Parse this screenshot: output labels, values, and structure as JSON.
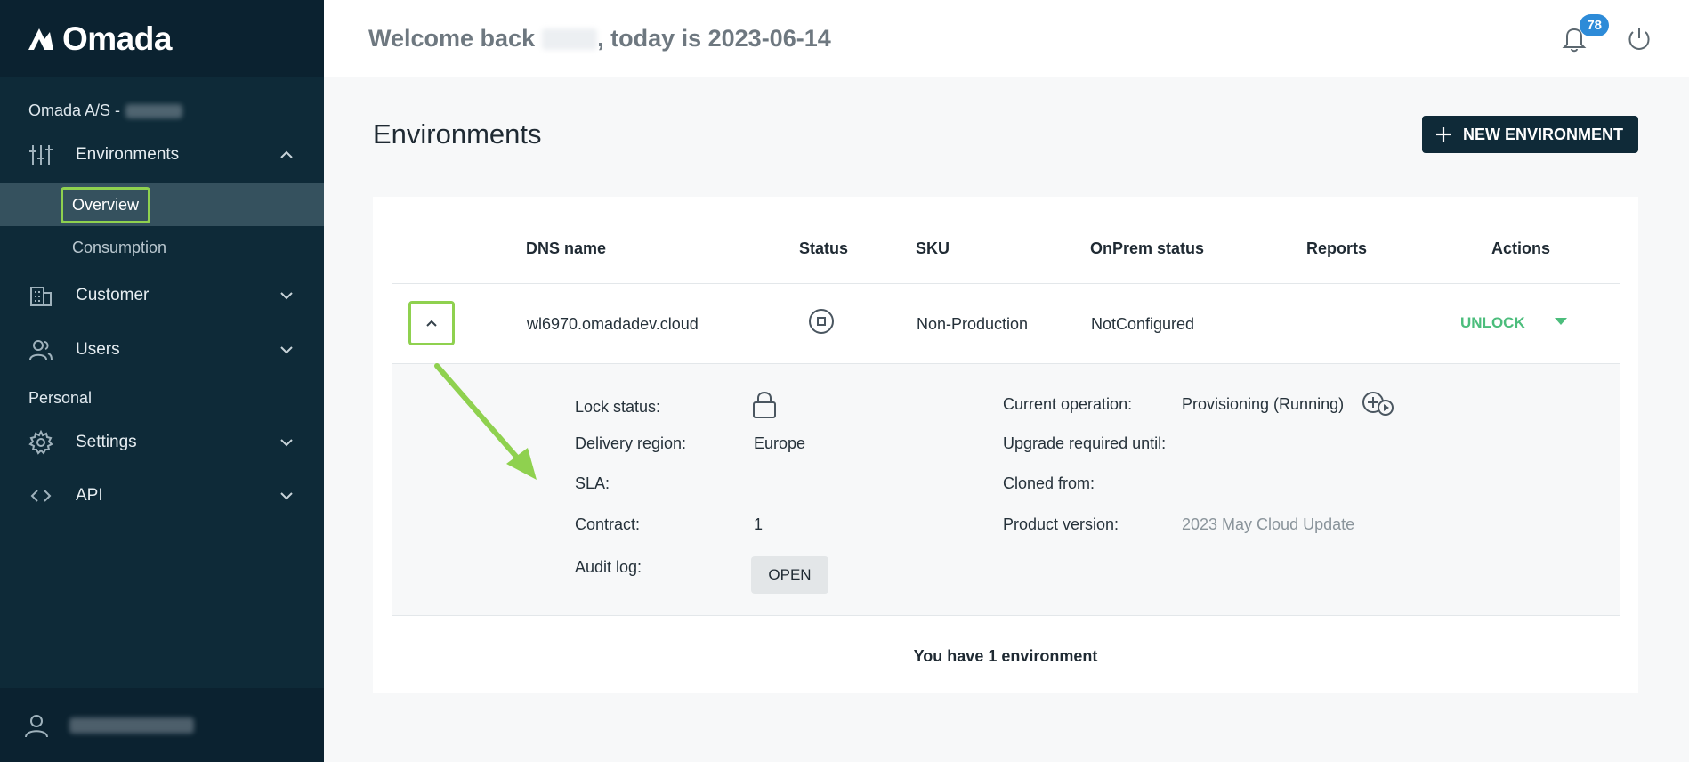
{
  "brand": {
    "name": "Omada"
  },
  "sidebar": {
    "org_label": "Omada A/S -",
    "nav": [
      {
        "label": "Environments",
        "icon": "sliders-icon",
        "expanded": true
      },
      {
        "label": "Customer",
        "icon": "building-icon"
      },
      {
        "label": "Users",
        "icon": "users-icon"
      },
      {
        "label": "Settings",
        "icon": "gear-icon"
      },
      {
        "label": "API",
        "icon": "code-icon"
      }
    ],
    "sub_items": [
      {
        "label": "Overview",
        "active": true
      },
      {
        "label": "Consumption"
      }
    ],
    "section_personal": "Personal"
  },
  "header": {
    "welcome_prefix": "Welcome back",
    "welcome_suffix": ", today is 2023-06-14",
    "notification_count": "78"
  },
  "page": {
    "title": "Environments",
    "new_button": "NEW ENVIRONMENT"
  },
  "table": {
    "columns": [
      "DNS name",
      "Status",
      "SKU",
      "OnPrem status",
      "Reports",
      "Actions"
    ],
    "row": {
      "dns": "wl6970.omadadev.cloud",
      "sku": "Non-Production",
      "onprem": "NotConfigured",
      "action": "UNLOCK"
    },
    "details": {
      "lock_status_label": "Lock status:",
      "delivery_region_label": "Delivery region:",
      "delivery_region_value": "Europe",
      "sla_label": "SLA:",
      "contract_label": "Contract:",
      "contract_value": "1",
      "audit_log_label": "Audit log:",
      "audit_log_button": "OPEN",
      "current_operation_label": "Current operation:",
      "current_operation_value": "Provisioning (Running)",
      "upgrade_label": "Upgrade required until:",
      "cloned_label": "Cloned from:",
      "product_version_label": "Product version:",
      "product_version_value": "2023 May Cloud Update"
    },
    "footer": "You have 1 environment"
  },
  "colors": {
    "sidebar": "#0e2a38",
    "highlight": "#8fd14f",
    "accent_green": "#4cbd7c",
    "badge_blue": "#2d8bd8"
  }
}
